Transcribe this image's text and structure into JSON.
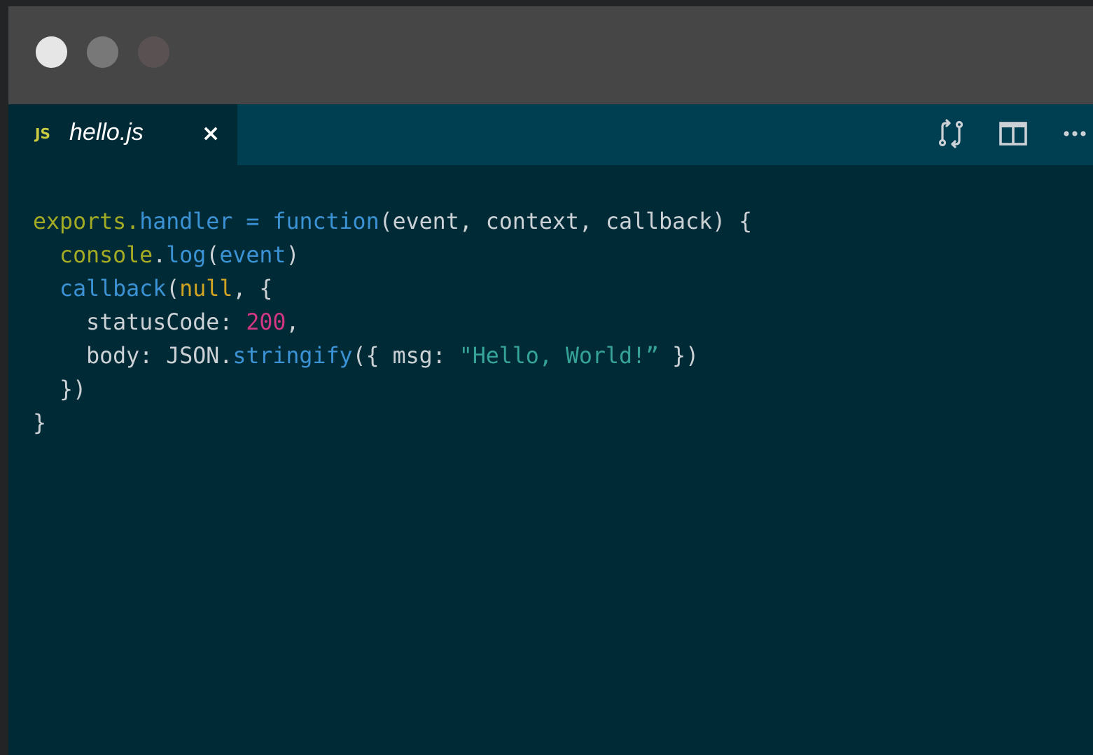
{
  "window": {
    "traffic_lights": [
      {
        "name": "close",
        "color": "#e6e6e6"
      },
      {
        "name": "minimize",
        "color": "#787878"
      },
      {
        "name": "maximize",
        "color": "#5a5252"
      }
    ]
  },
  "tabs": [
    {
      "badge": "JS",
      "name": "hello.js",
      "close_glyph": "×",
      "icon": "javascript-file-icon",
      "active": true
    }
  ],
  "actions": [
    {
      "icon": "open-changes-icon"
    },
    {
      "icon": "split-editor-icon"
    },
    {
      "icon": "more-actions-icon"
    }
  ],
  "colors": {
    "titlebar": "#464646",
    "tabbar": "#003e51",
    "editor_bg": "#002b36",
    "plain": "#ccd1d6",
    "object": "#a3aa23",
    "property": "#3b93d5",
    "null": "#d3a422",
    "number": "#d33682",
    "string": "#36a39a"
  },
  "code": {
    "language": "javascript",
    "lines": [
      [
        {
          "t": "exports",
          "c": "obj"
        },
        {
          "t": ".",
          "c": "obj"
        },
        {
          "t": "handler",
          "c": "prop"
        },
        {
          "t": " = ",
          "c": "prop"
        },
        {
          "t": "function",
          "c": "kw"
        },
        {
          "t": "(event, context, callback) {",
          "c": "plain"
        }
      ],
      [
        {
          "t": "  ",
          "c": "plain"
        },
        {
          "t": "console",
          "c": "obj"
        },
        {
          "t": ".",
          "c": "plain"
        },
        {
          "t": "log",
          "c": "prop"
        },
        {
          "t": "(",
          "c": "plain"
        },
        {
          "t": "event",
          "c": "param"
        },
        {
          "t": ")",
          "c": "plain"
        }
      ],
      [
        {
          "t": "  ",
          "c": "plain"
        },
        {
          "t": "callback",
          "c": "prop"
        },
        {
          "t": "(",
          "c": "plain"
        },
        {
          "t": "null",
          "c": "null"
        },
        {
          "t": ", {",
          "c": "plain"
        }
      ],
      [
        {
          "t": "    statusCode: ",
          "c": "plain"
        },
        {
          "t": "200",
          "c": "num"
        },
        {
          "t": ",",
          "c": "plain"
        }
      ],
      [
        {
          "t": "    body: JSON.",
          "c": "plain"
        },
        {
          "t": "stringify",
          "c": "prop"
        },
        {
          "t": "({ msg: ",
          "c": "plain"
        },
        {
          "t": "\"Hello, World!”",
          "c": "str"
        },
        {
          "t": " })",
          "c": "plain"
        }
      ],
      [
        {
          "t": "  })",
          "c": "plain"
        }
      ],
      [
        {
          "t": "}",
          "c": "plain"
        }
      ]
    ]
  }
}
